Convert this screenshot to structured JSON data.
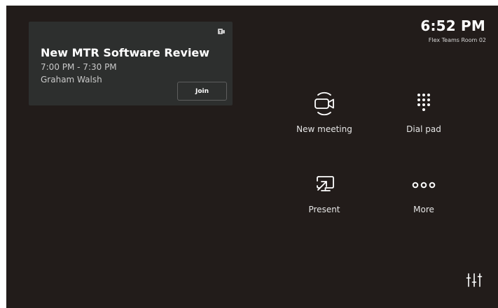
{
  "meeting_card": {
    "title": "New MTR Software Review",
    "time": "7:00 PM - 7:30 PM",
    "organizer": "Graham Walsh",
    "join_label": "Join",
    "icon": "teams-icon"
  },
  "header": {
    "clock": "6:52 PM",
    "room_name": "Flex Teams Room 02"
  },
  "actions": [
    {
      "label": "New meeting",
      "icon": "video-camera-icon"
    },
    {
      "label": "Dial pad",
      "icon": "dial-pad-icon"
    },
    {
      "label": "Present",
      "icon": "present-screen-icon"
    },
    {
      "label": "More",
      "icon": "more-icon"
    }
  ],
  "settings": {
    "icon": "settings-sliders-icon"
  },
  "colors": {
    "background": "#221c1a",
    "card": "#2d2f2e",
    "text": "#ffffff"
  }
}
